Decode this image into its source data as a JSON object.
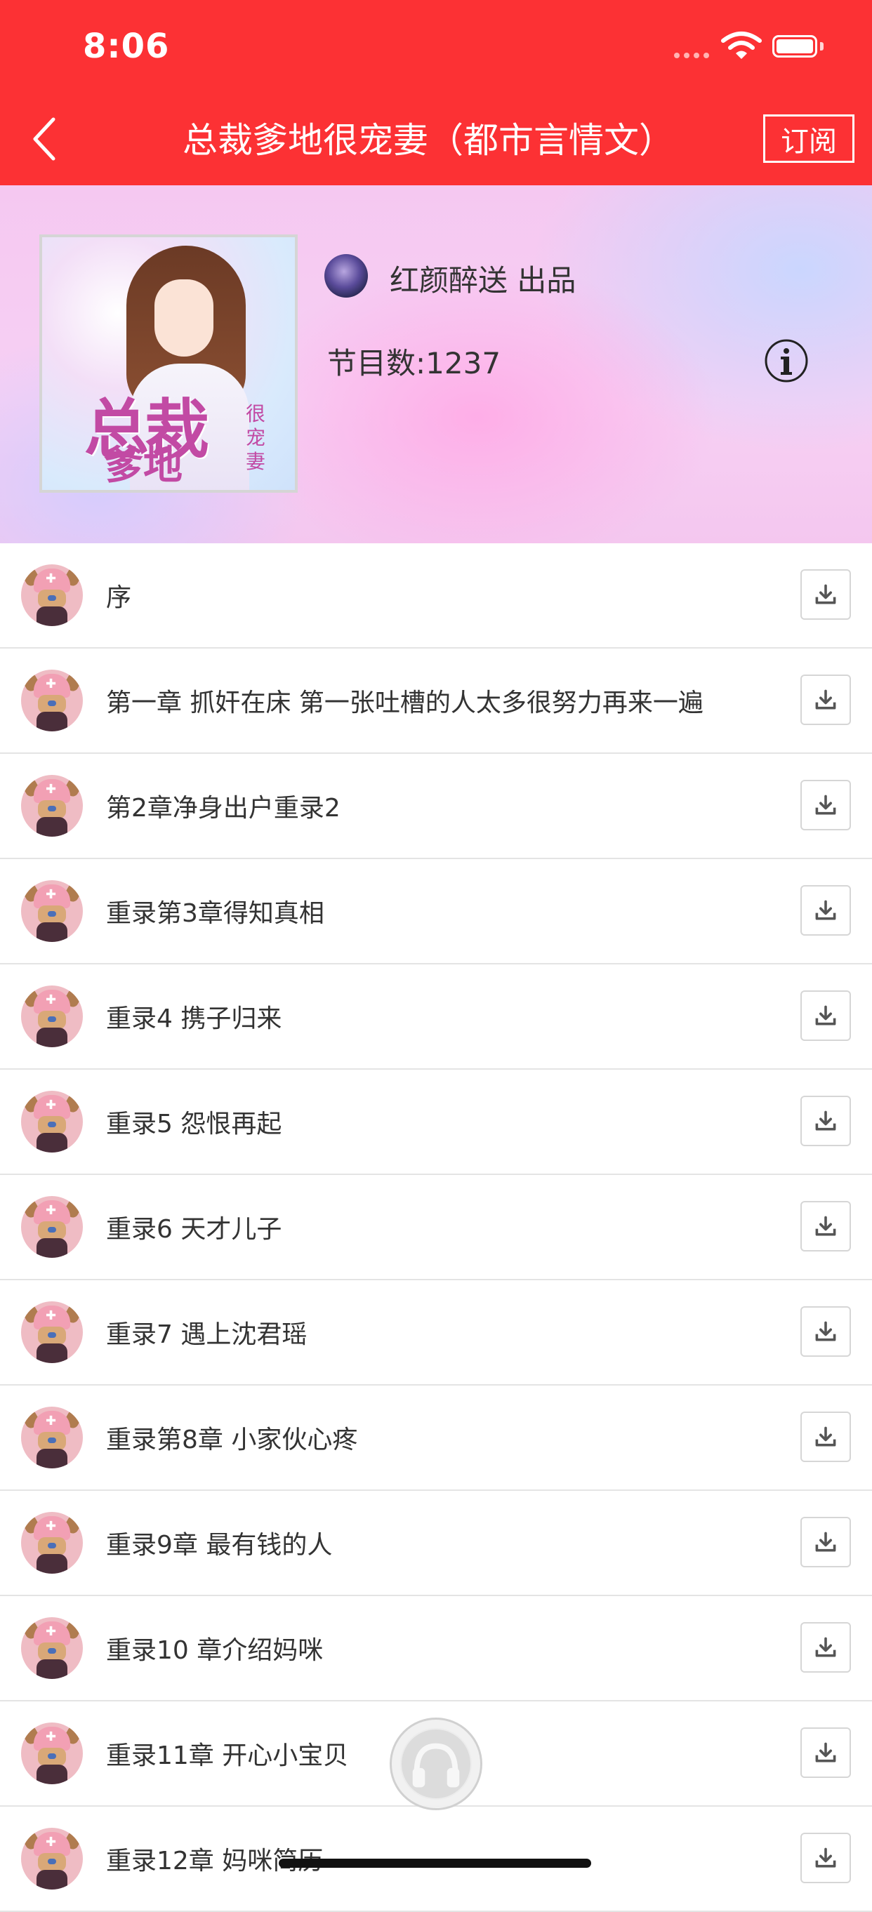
{
  "status_bar": {
    "time": "8:06"
  },
  "nav": {
    "title": "总裁爹地很宠妻（都市言情文）",
    "subscribe_label": "订阅"
  },
  "album": {
    "cover_text_main": "总裁",
    "cover_text_sub": "爹地",
    "cover_text_side": "很宠妻",
    "publisher": "红颜醉送 出品",
    "episode_count": "节目数:1237"
  },
  "episodes": [
    {
      "title": "序"
    },
    {
      "title": "第一章 抓奸在床 第一张吐槽的人太多很努力再来一遍"
    },
    {
      "title": "第2章净身出户重录2"
    },
    {
      "title": "重录第3章得知真相"
    },
    {
      "title": "重录4 携子归来"
    },
    {
      "title": "重录5 怨恨再起"
    },
    {
      "title": "重录6 天才儿子"
    },
    {
      "title": "重录7 遇上沈君瑶"
    },
    {
      "title": "重录第8章 小家伙心疼"
    },
    {
      "title": "重录9章 最有钱的人"
    },
    {
      "title": "重录10 章介绍妈咪"
    },
    {
      "title": "重录11章 开心小宝贝"
    },
    {
      "title": "重录12章 妈咪简历"
    }
  ],
  "icons": {
    "back": "chevron-left-icon",
    "info": "info-icon",
    "download": "download-icon",
    "player": "headphones-icon"
  },
  "colors": {
    "brand_red": "#fc3134"
  }
}
